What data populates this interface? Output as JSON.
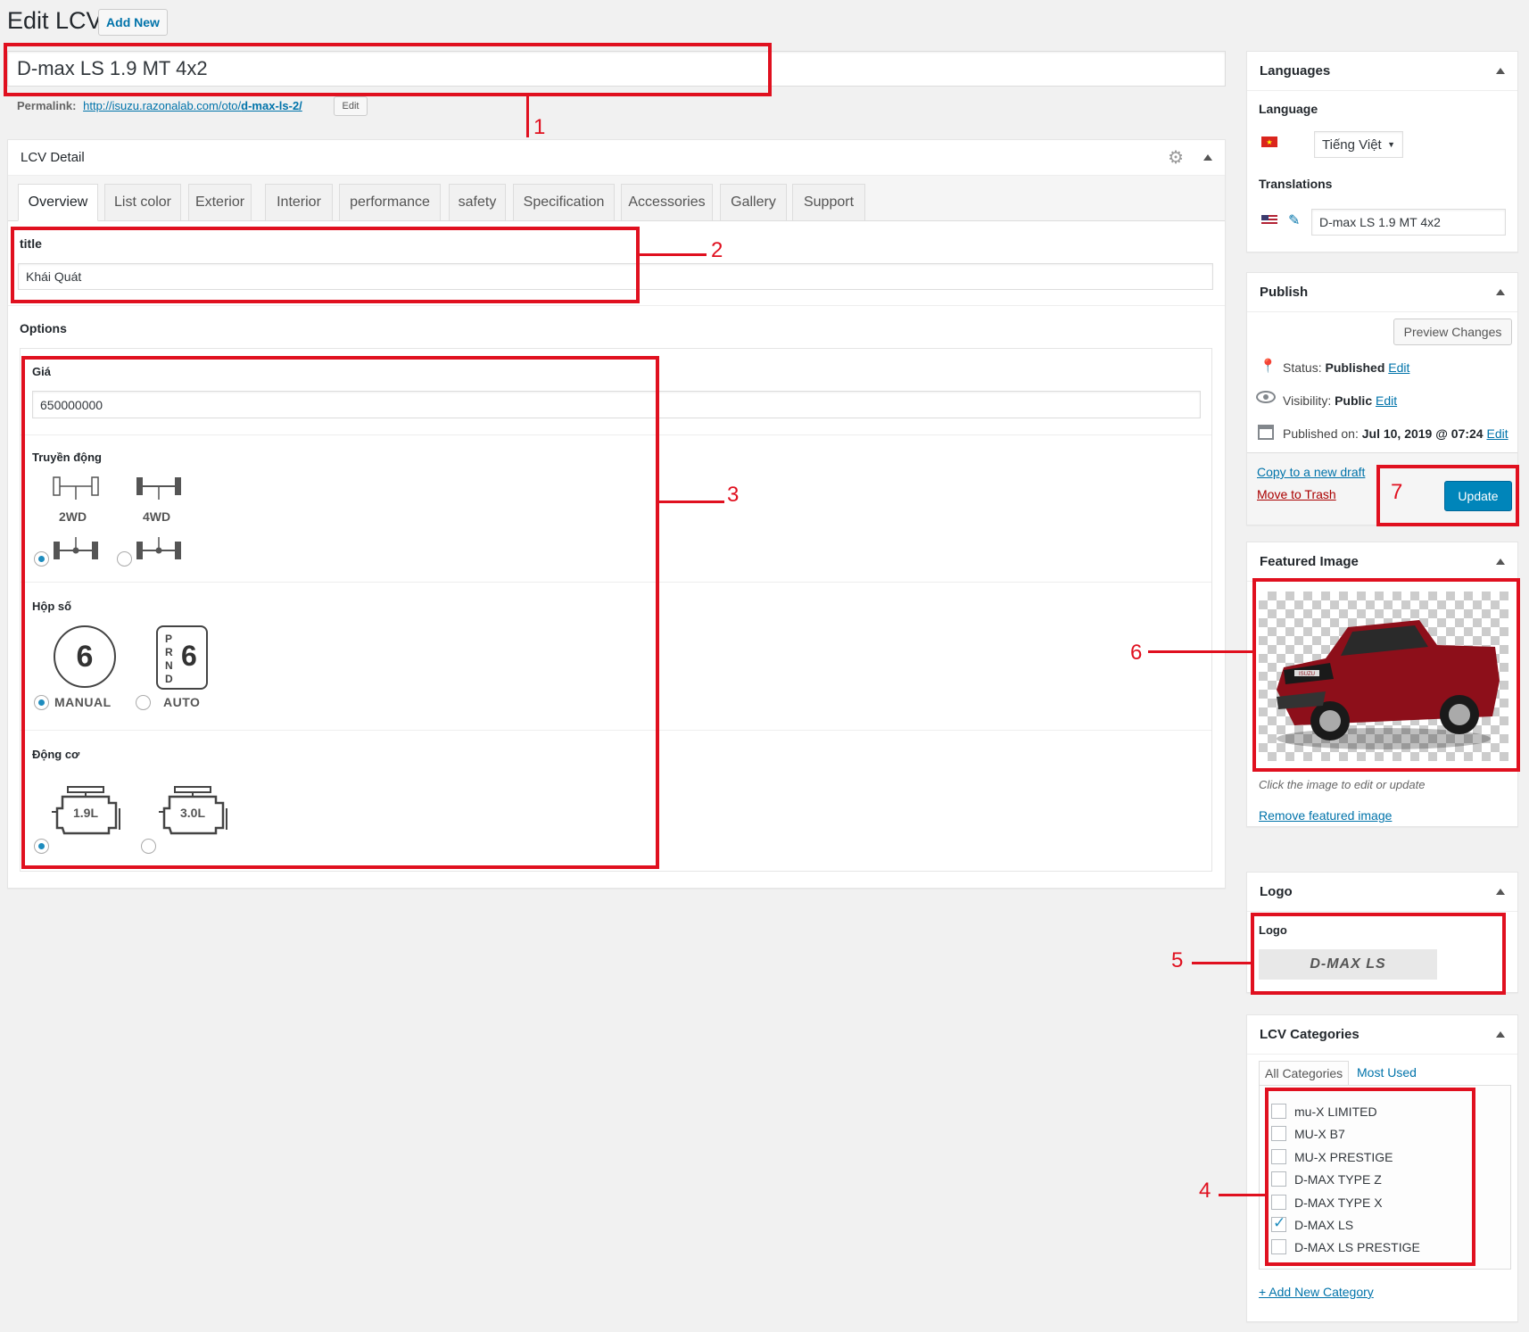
{
  "page": {
    "heading": "Edit LCV",
    "add_new": "Add New",
    "post_title": "D-max LS 1.9 MT 4x2",
    "permalink_label": "Permalink:",
    "permalink_base": "http://isuzu.razonalab.com/oto/",
    "permalink_slug": "d-max-ls-2/",
    "permalink_edit": "Edit"
  },
  "lcv_detail": {
    "title": "LCV Detail",
    "tabs": [
      "Overview",
      "List color",
      "Exterior",
      "Interior",
      "performance",
      "safety",
      "Specification",
      "Accessories",
      "Gallery",
      "Support"
    ],
    "active_tab": "Overview",
    "title_label": "title",
    "title_value": "Khái Quát",
    "options_label": "Options",
    "price_label": "Giá",
    "price_value": "650000000",
    "drive_label": "Truyền động",
    "drive_options": [
      "2WD",
      "4WD"
    ],
    "drive_selected": "2WD",
    "gearbox_label": "Hộp số",
    "gearbox_options": [
      "MANUAL",
      "AUTO"
    ],
    "gearbox_selected": "MANUAL",
    "gear_count": "6",
    "auto_letters": "PRND",
    "engine_label": "Động cơ",
    "engine_options": [
      "1.9L",
      "3.0L"
    ],
    "engine_selected": "1.9L"
  },
  "languages": {
    "title": "Languages",
    "language_label": "Language",
    "language_value": "Tiếng Việt",
    "translations_label": "Translations",
    "translation_value": "D-max LS 1.9 MT 4x2"
  },
  "publish": {
    "title": "Publish",
    "preview": "Preview Changes",
    "status_label": "Status:",
    "status_value": "Published",
    "visibility_label": "Visibility:",
    "visibility_value": "Public",
    "published_label": "Published on:",
    "published_value": "Jul 10, 2019 @ 07:24",
    "edit": "Edit",
    "copy_draft": "Copy to a new draft",
    "trash": "Move to Trash",
    "update": "Update"
  },
  "featured_image": {
    "title": "Featured Image",
    "hint": "Click the image to edit or update",
    "remove": "Remove featured image",
    "car_badge": "ISUZU"
  },
  "logo": {
    "title": "Logo",
    "label": "Logo",
    "logo_text": "D-MAX LS"
  },
  "categories": {
    "title": "LCV Categories",
    "tab_all": "All Categories",
    "tab_most": "Most Used",
    "items": [
      {
        "label": "mu-X LIMITED",
        "checked": false
      },
      {
        "label": "MU-X B7",
        "checked": false
      },
      {
        "label": "MU-X PRESTIGE",
        "checked": false
      },
      {
        "label": "D-MAX TYPE Z",
        "checked": false
      },
      {
        "label": "D-MAX TYPE X",
        "checked": false
      },
      {
        "label": "D-MAX LS",
        "checked": true
      },
      {
        "label": "D-MAX LS PRESTIGE",
        "checked": false
      }
    ],
    "add_new": "+ Add New Category"
  },
  "annotations": [
    "1",
    "2",
    "3",
    "4",
    "5",
    "6",
    "7"
  ],
  "colors": {
    "highlight": "#e0101f",
    "primary": "#0085ba",
    "link": "#0073aa",
    "trash": "#a00"
  }
}
